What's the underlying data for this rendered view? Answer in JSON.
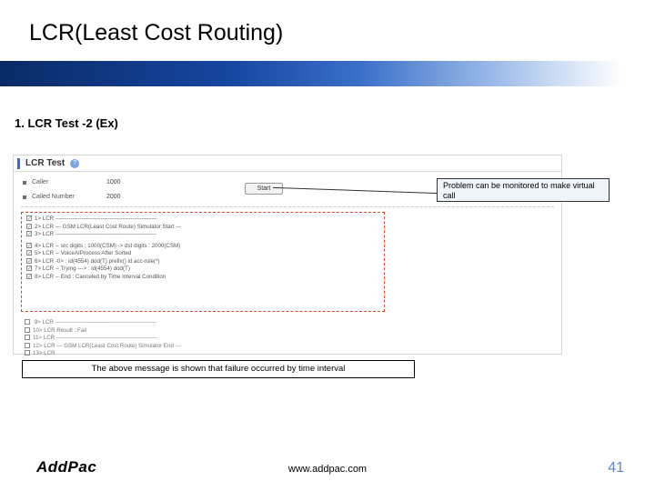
{
  "title": "LCR(Least Cost Routing)",
  "subtitle": "1. LCR Test -2 (Ex)",
  "panel": {
    "header": "LCR Test",
    "caller_label": "Caller",
    "caller_value": "1000",
    "called_label": "Called Number",
    "called_value": "2000",
    "start": "Start"
  },
  "log": [
    "1> LCR  ------------------------------------------------------",
    "2> LCR  --- GSM LCR(Least Cost Route) Simulator Start    ---",
    "3> LCR  ------------------------------------------------------",
    "4> LCR  -- src digits : 1000(CSM) -> dst digits : 2000(CSM)",
    "5> LCR  -- VoiceAIProcess After Sorted",
    "6> LCR        -0> : id(4554) dod(T) prefix() id acc-rule(*)",
    "7> LCR  -- Trying ---> : id(4554) dod(T)",
    "8> LCR  -- End :  Canceled by Time Interval Condition"
  ],
  "ext_log": [
    "  9> LCR  ------------------------------------------------------",
    "10> LCR         Result : Fail",
    "11> LCR  ------------------------------------------------------",
    "12> LCR  --- GSM LCR(Least Cost Route) Simulator End     ---",
    "13> LCR  "
  ],
  "callout1": "Problem can be monitored to make virtual call",
  "callout2": "The above message is shown that failure occurred by time interval",
  "brand": "AddPac",
  "url": "www.addpac.com",
  "page": "41"
}
